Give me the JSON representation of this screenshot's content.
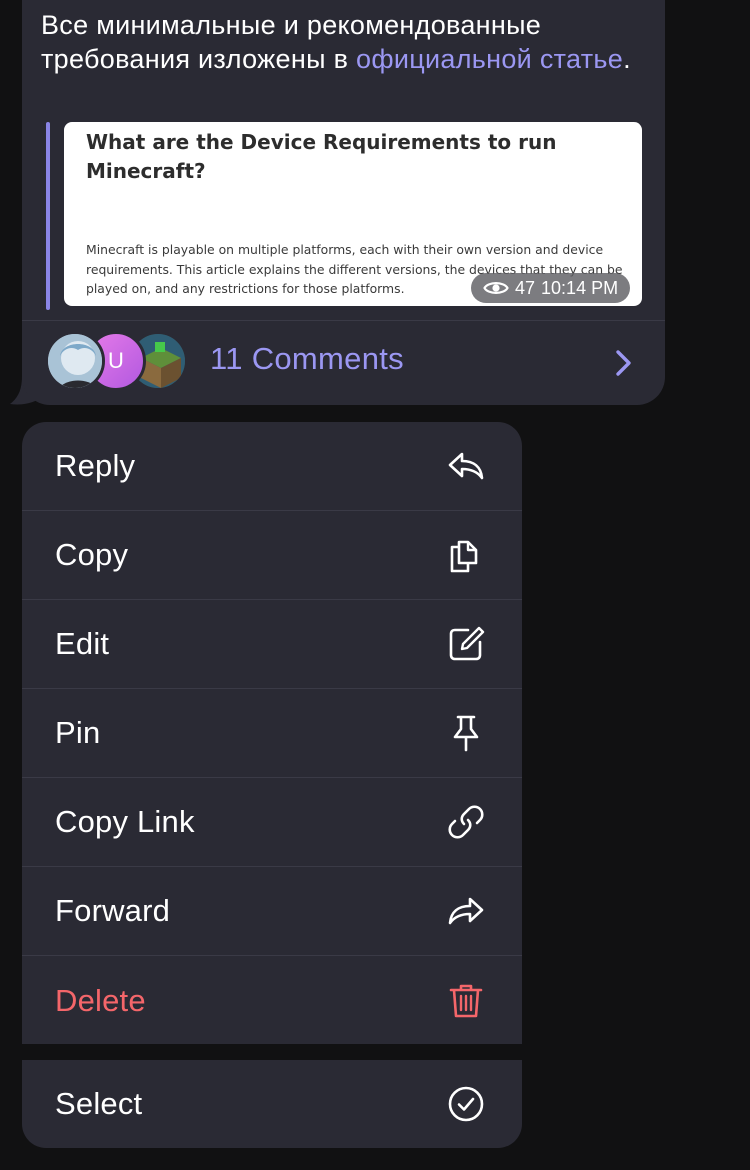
{
  "message": {
    "text": "Все минимальные и рекомендованные требования изложены в ",
    "link_text": "официальной статье",
    "text_end": ".",
    "link_color": "#9b97f2"
  },
  "link_preview": {
    "title": "What are the Device Requirements to run Minecraft?",
    "description": "Minecraft is playable on multiple platforms, each with their own version and device requirements. This article explains the different versions, the devices that they can be played on, and any restrictions for those platforms.",
    "views": "47",
    "time": "10:14 PM"
  },
  "comments": {
    "label": "11 Comments",
    "avatars": [
      {
        "name": "avatar-anime-character",
        "initial": ""
      },
      {
        "name": "avatar-initial-u",
        "initial": "U"
      },
      {
        "name": "avatar-minecraft-block",
        "initial": ""
      }
    ]
  },
  "menu": {
    "items": [
      {
        "label": "Reply",
        "icon": "reply-icon"
      },
      {
        "label": "Copy",
        "icon": "copy-icon"
      },
      {
        "label": "Edit",
        "icon": "edit-icon"
      },
      {
        "label": "Pin",
        "icon": "pin-icon"
      },
      {
        "label": "Copy Link",
        "icon": "link-icon"
      },
      {
        "label": "Forward",
        "icon": "forward-icon"
      },
      {
        "label": "Delete",
        "icon": "trash-icon",
        "color": "#f4666a"
      }
    ],
    "select": {
      "label": "Select",
      "icon": "checkmark-circle-icon"
    }
  },
  "colors": {
    "background": "#111112",
    "surface": "#2a2a34",
    "accent": "#9b97f2",
    "danger": "#f4666a"
  }
}
